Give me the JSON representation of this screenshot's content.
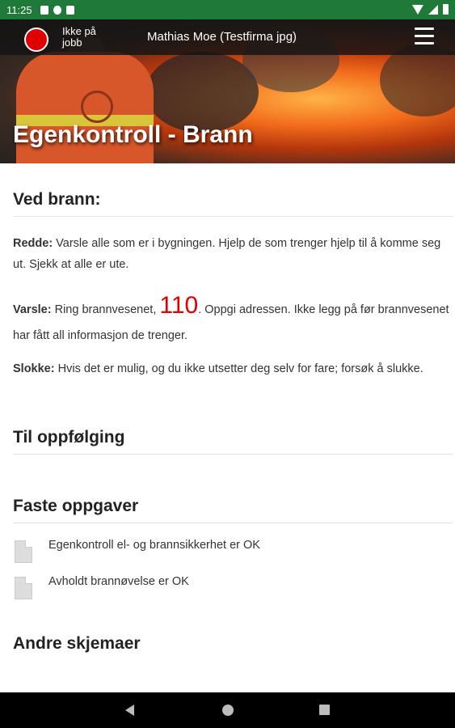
{
  "status_bar": {
    "time": "11:25"
  },
  "header": {
    "status_label": "Ikke på jobb",
    "user_title": "Mathias Moe (Testfirma jpg)",
    "page_title": "Egenkontroll - Brann"
  },
  "fire_section": {
    "heading": "Ved brann:",
    "redde_label": "Redde:",
    "redde_text": " Varsle alle som er i bygningen. Hjelp de som trenger hjelp til å komme seg ut. Sjekk at alle er ute.",
    "varsle_label": "Varsle:",
    "varsle_pre": " Ring brannvesenet, ",
    "emergency_number": "110",
    "varsle_post": ". Oppgi adressen. Ikke legg på før brannvesenet har fått all informasjon de trenger.",
    "slokke_label": "Slokke:",
    "slokke_text": " Hvis det er mulig, og du ikke utsetter deg selv for fare; forsøk å slukke."
  },
  "followup_section": {
    "heading": "Til oppfølging"
  },
  "tasks_section": {
    "heading": "Faste oppgaver",
    "items": [
      {
        "label": "Egenkontroll el- og brannsikkerhet er OK"
      },
      {
        "label": "Avholdt brannøvelse er OK"
      }
    ]
  },
  "other_forms_section": {
    "heading": "Andre skjemaer"
  },
  "colors": {
    "status_bar": "#1f7a3a",
    "accent_red": "#e00000"
  }
}
